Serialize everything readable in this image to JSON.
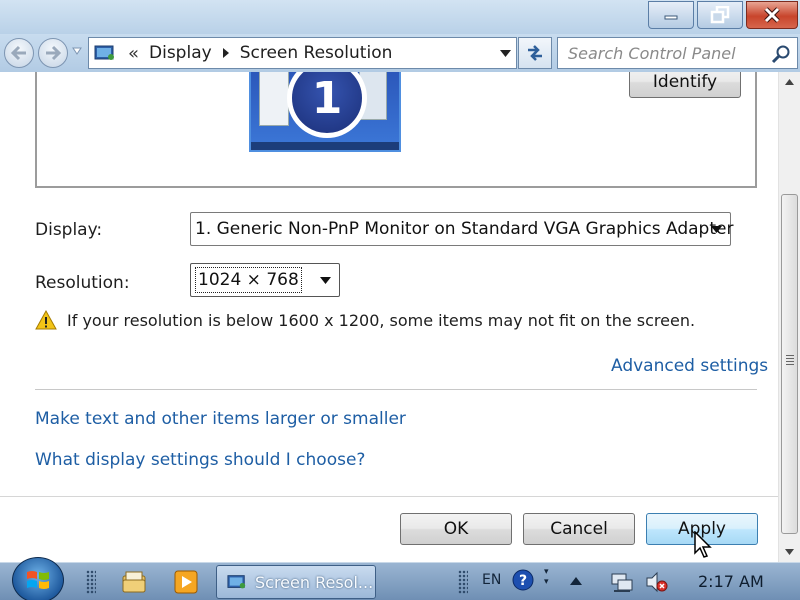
{
  "window": {
    "caption_buttons": {
      "minimize": "minimize-icon",
      "maximize": "restore-icon",
      "close": "close-icon"
    }
  },
  "navbar": {
    "breadcrumb_sep": "«",
    "breadcrumbs": [
      "Display",
      "Screen Resolution"
    ],
    "search_placeholder": "Search Control Panel"
  },
  "content": {
    "monitor_number": "1",
    "identify_label": "Identify",
    "display_label": "Display:",
    "display_value": "1. Generic Non-PnP Monitor on Standard VGA Graphics Adapter",
    "resolution_label": "Resolution:",
    "resolution_value": "1024 × 768",
    "warning_text": "If your resolution is below 1600 x 1200, some items may not fit on the screen.",
    "advanced_settings": "Advanced settings",
    "link_text_size": "Make text and other items larger or smaller",
    "link_help": "What display settings should I choose?",
    "ok_label": "OK",
    "cancel_label": "Cancel",
    "apply_label": "Apply"
  },
  "taskbar": {
    "task_label": "Screen Resol...",
    "language": "EN",
    "clock": "2:17 AM"
  },
  "colors": {
    "link": "#1e5ea4",
    "titlebar": "#c8dcef",
    "close_button": "#c8452c",
    "taskbar": "#7f9ec2"
  }
}
